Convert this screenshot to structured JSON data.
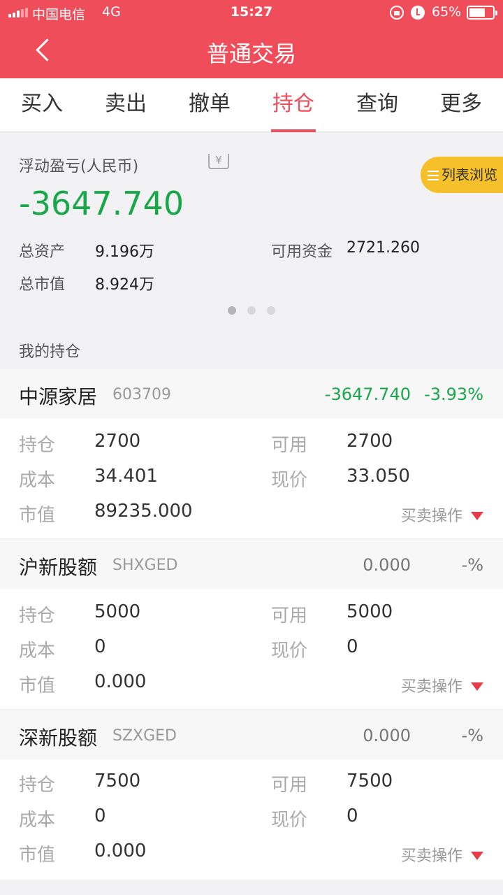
{
  "status": {
    "carrier": "中国电信",
    "network": "4G",
    "time": "15:27",
    "battery": "65%"
  },
  "header": {
    "title": "普通交易",
    "back_icon": "chevron-left-icon"
  },
  "tabs": [
    {
      "label": "买入"
    },
    {
      "label": "卖出"
    },
    {
      "label": "撤单"
    },
    {
      "label": "持仓",
      "active": true
    },
    {
      "label": "查询"
    },
    {
      "label": "更多"
    }
  ],
  "summary": {
    "pl_label": "浮动盈亏(人民币)",
    "currency_icon_glyph": "¥",
    "pl_value": "-3647.740",
    "list_button": "列表浏览",
    "total_assets_label": "总资产",
    "total_assets": "9.196万",
    "available_funds_label": "可用资金",
    "available_funds": "2721.260",
    "market_value_label": "总市值",
    "market_value": "8.924万"
  },
  "section_title": "我的持仓",
  "field_labels": {
    "holding": "持仓",
    "available": "可用",
    "cost": "成本",
    "price": "现价",
    "value": "市值"
  },
  "action_label": "买卖操作",
  "holdings": [
    {
      "name": "中源家居",
      "code": "603709",
      "pl": "-3647.740",
      "pct": "-3.93%",
      "holding": "2700",
      "available": "2700",
      "cost": "34.401",
      "price": "33.050",
      "value": "89235.000"
    },
    {
      "name": "沪新股额",
      "code": "SHXGED",
      "pl": "0.000",
      "pct": "-%",
      "holding": "5000",
      "available": "5000",
      "cost": "0",
      "price": "0",
      "value": "0.000"
    },
    {
      "name": "深新股额",
      "code": "SZXGED",
      "pl": "0.000",
      "pct": "-%",
      "holding": "7500",
      "available": "7500",
      "cost": "0",
      "price": "0",
      "value": "0.000"
    }
  ],
  "colors": {
    "brand": "#f04d5b",
    "loss": "#18a84a",
    "accent_button": "#f5c02a"
  }
}
